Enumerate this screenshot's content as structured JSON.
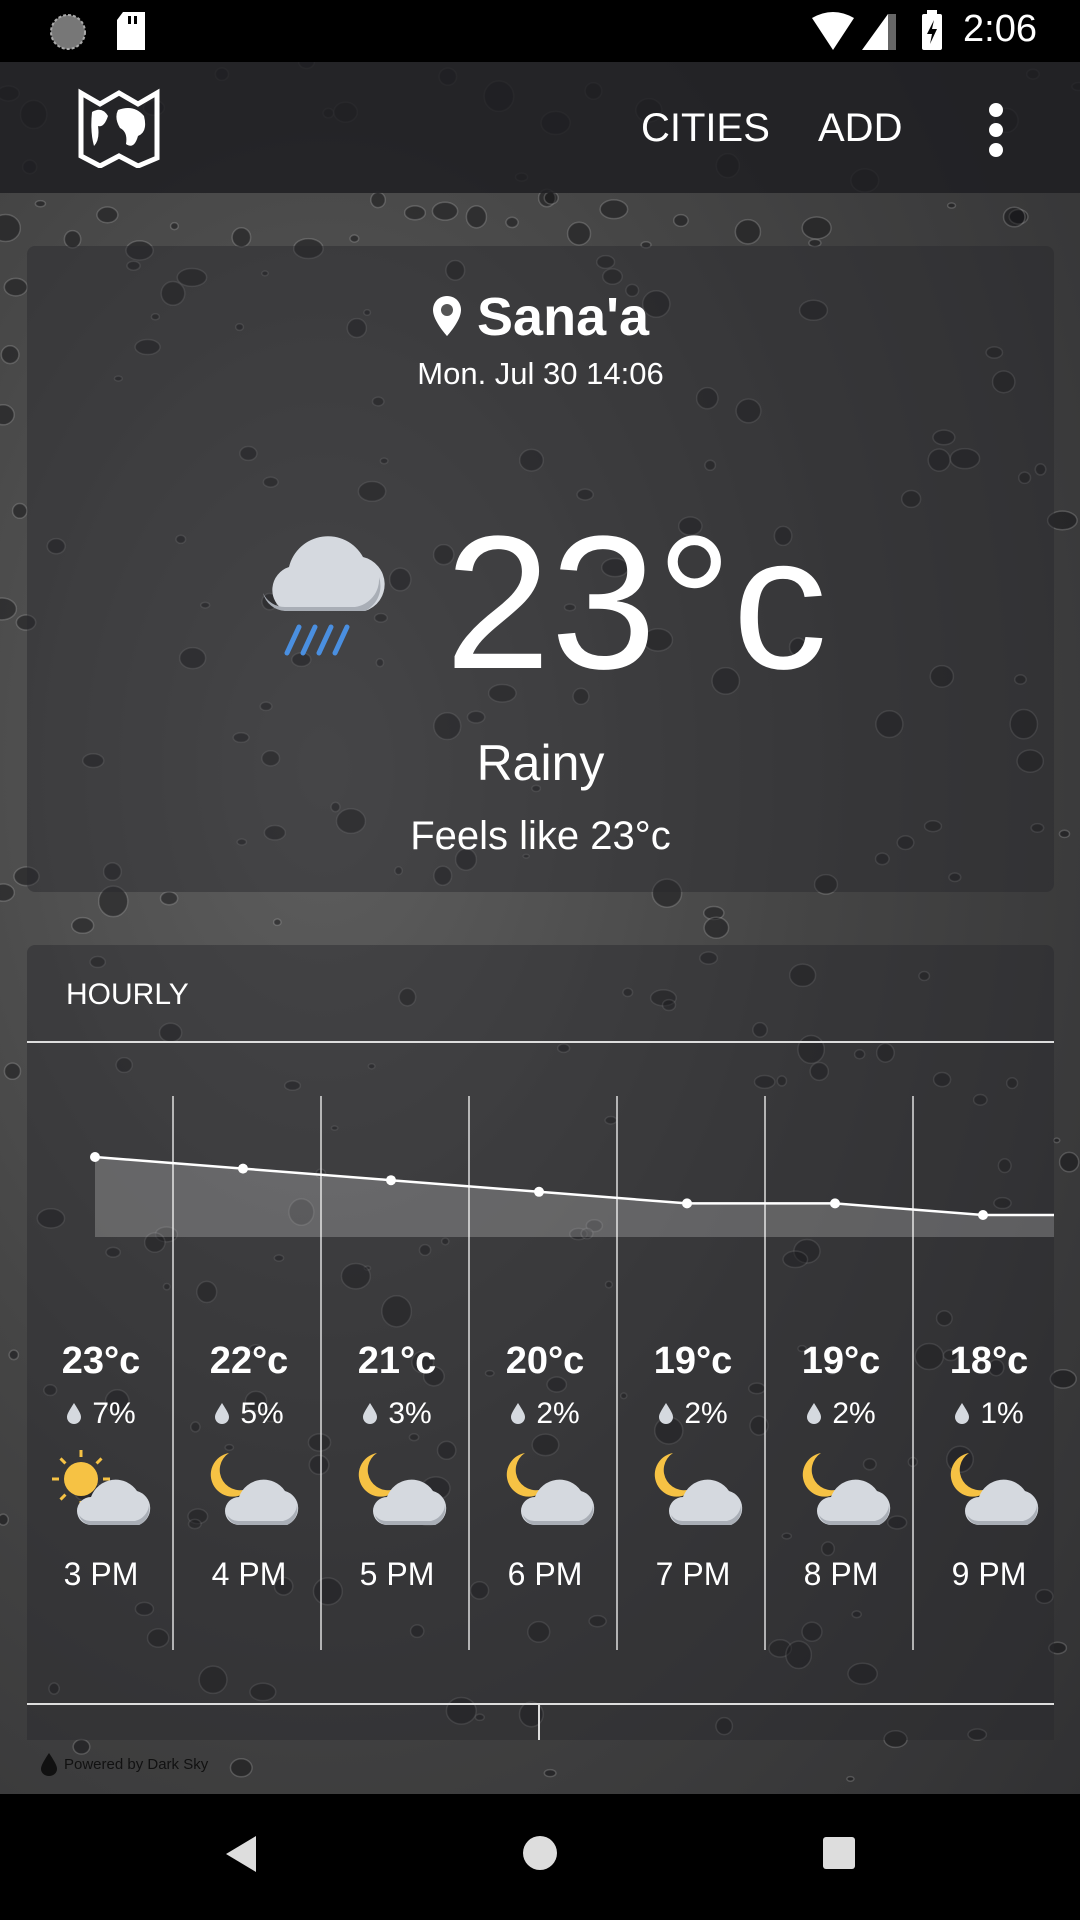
{
  "status_bar": {
    "time": "2:06",
    "icons": [
      "sync-icon",
      "sd-card-icon",
      "wifi-icon",
      "signal-icon",
      "battery-charging-icon"
    ]
  },
  "app_bar": {
    "logo": "world-map-icon",
    "cities_label": "CITIES",
    "add_label": "ADD",
    "menu": "more-vert-icon"
  },
  "current": {
    "city": "Sana'a",
    "datetime": "Mon. Jul 30 14:06",
    "temperature": "23°c",
    "condition": "Rainy",
    "feels_like": "Feels like 23°c",
    "icon": "cloud-rain-icon"
  },
  "hourly": {
    "title": "HOURLY",
    "items": [
      {
        "temp": "23°c",
        "temp_value": 23,
        "precip": "7%",
        "icon": "partly-cloudy-day-icon",
        "time": "3 PM"
      },
      {
        "temp": "22°c",
        "temp_value": 22,
        "precip": "5%",
        "icon": "partly-cloudy-night-icon",
        "time": "4 PM"
      },
      {
        "temp": "21°c",
        "temp_value": 21,
        "precip": "3%",
        "icon": "partly-cloudy-night-icon",
        "time": "5 PM"
      },
      {
        "temp": "20°c",
        "temp_value": 20,
        "precip": "2%",
        "icon": "partly-cloudy-night-icon",
        "time": "6 PM"
      },
      {
        "temp": "19°c",
        "temp_value": 19,
        "precip": "2%",
        "icon": "partly-cloudy-night-icon",
        "time": "7 PM"
      },
      {
        "temp": "19°c",
        "temp_value": 19,
        "precip": "2%",
        "icon": "partly-cloudy-night-icon",
        "time": "8 PM"
      },
      {
        "temp": "18°c",
        "temp_value": 18,
        "precip": "1%",
        "icon": "partly-cloudy-night-icon",
        "time": "9 PM"
      }
    ]
  },
  "footer": {
    "powered_by": "Powered by Dark Sky"
  },
  "colors": {
    "rain": "#4a8fe0",
    "sun": "#f6c244",
    "cloud": "#d5d9df"
  }
}
